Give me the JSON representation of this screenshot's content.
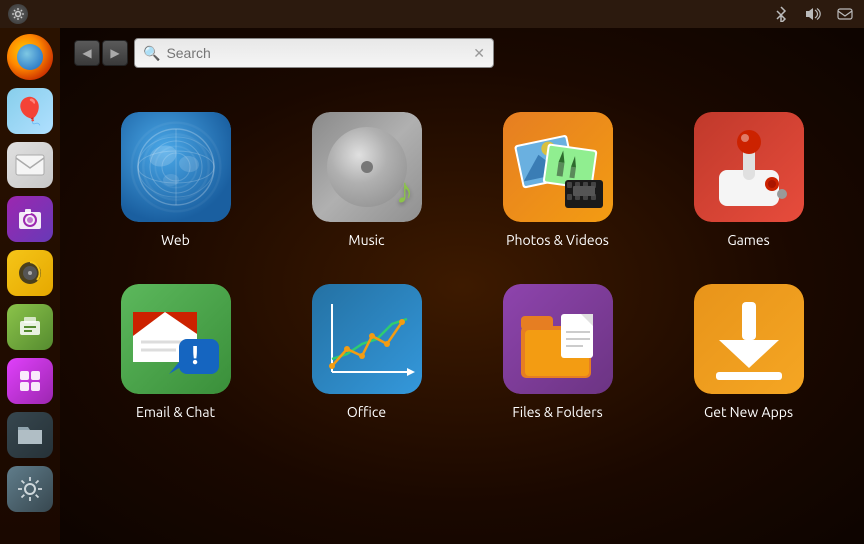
{
  "topbar": {
    "system_menu_label": "⚙",
    "bluetooth_icon": "bluetooth",
    "volume_icon": "volume",
    "mail_icon": "mail"
  },
  "search": {
    "placeholder": "Search",
    "value": ""
  },
  "nav": {
    "back_label": "◀",
    "forward_label": "▶"
  },
  "sidebar": {
    "items": [
      {
        "name": "Firefox",
        "label": "firefox"
      },
      {
        "name": "Balloon",
        "label": "balloon"
      },
      {
        "name": "Mail",
        "label": "mail"
      },
      {
        "name": "Shotwell",
        "label": "shotwell"
      },
      {
        "name": "Rhythmbox",
        "label": "rhythmbox"
      },
      {
        "name": "Manager",
        "label": "manager"
      },
      {
        "name": "App Manager",
        "label": "appmanager"
      },
      {
        "name": "Files",
        "label": "files"
      },
      {
        "name": "System",
        "label": "system"
      }
    ]
  },
  "apps": [
    {
      "id": "web",
      "label": "Web"
    },
    {
      "id": "music",
      "label": "Music"
    },
    {
      "id": "photos",
      "label": "Photos & Videos"
    },
    {
      "id": "games",
      "label": "Games"
    },
    {
      "id": "email",
      "label": "Email & Chat"
    },
    {
      "id": "office",
      "label": "Office"
    },
    {
      "id": "files",
      "label": "Files & Folders"
    },
    {
      "id": "getnew",
      "label": "Get New Apps"
    }
  ],
  "colors": {
    "background": "#1a0800",
    "sidebar_bg": "#2a1200",
    "panel_bg": "#2c1a0e",
    "text_white": "#ffffff",
    "accent_orange": "#e67e22"
  }
}
